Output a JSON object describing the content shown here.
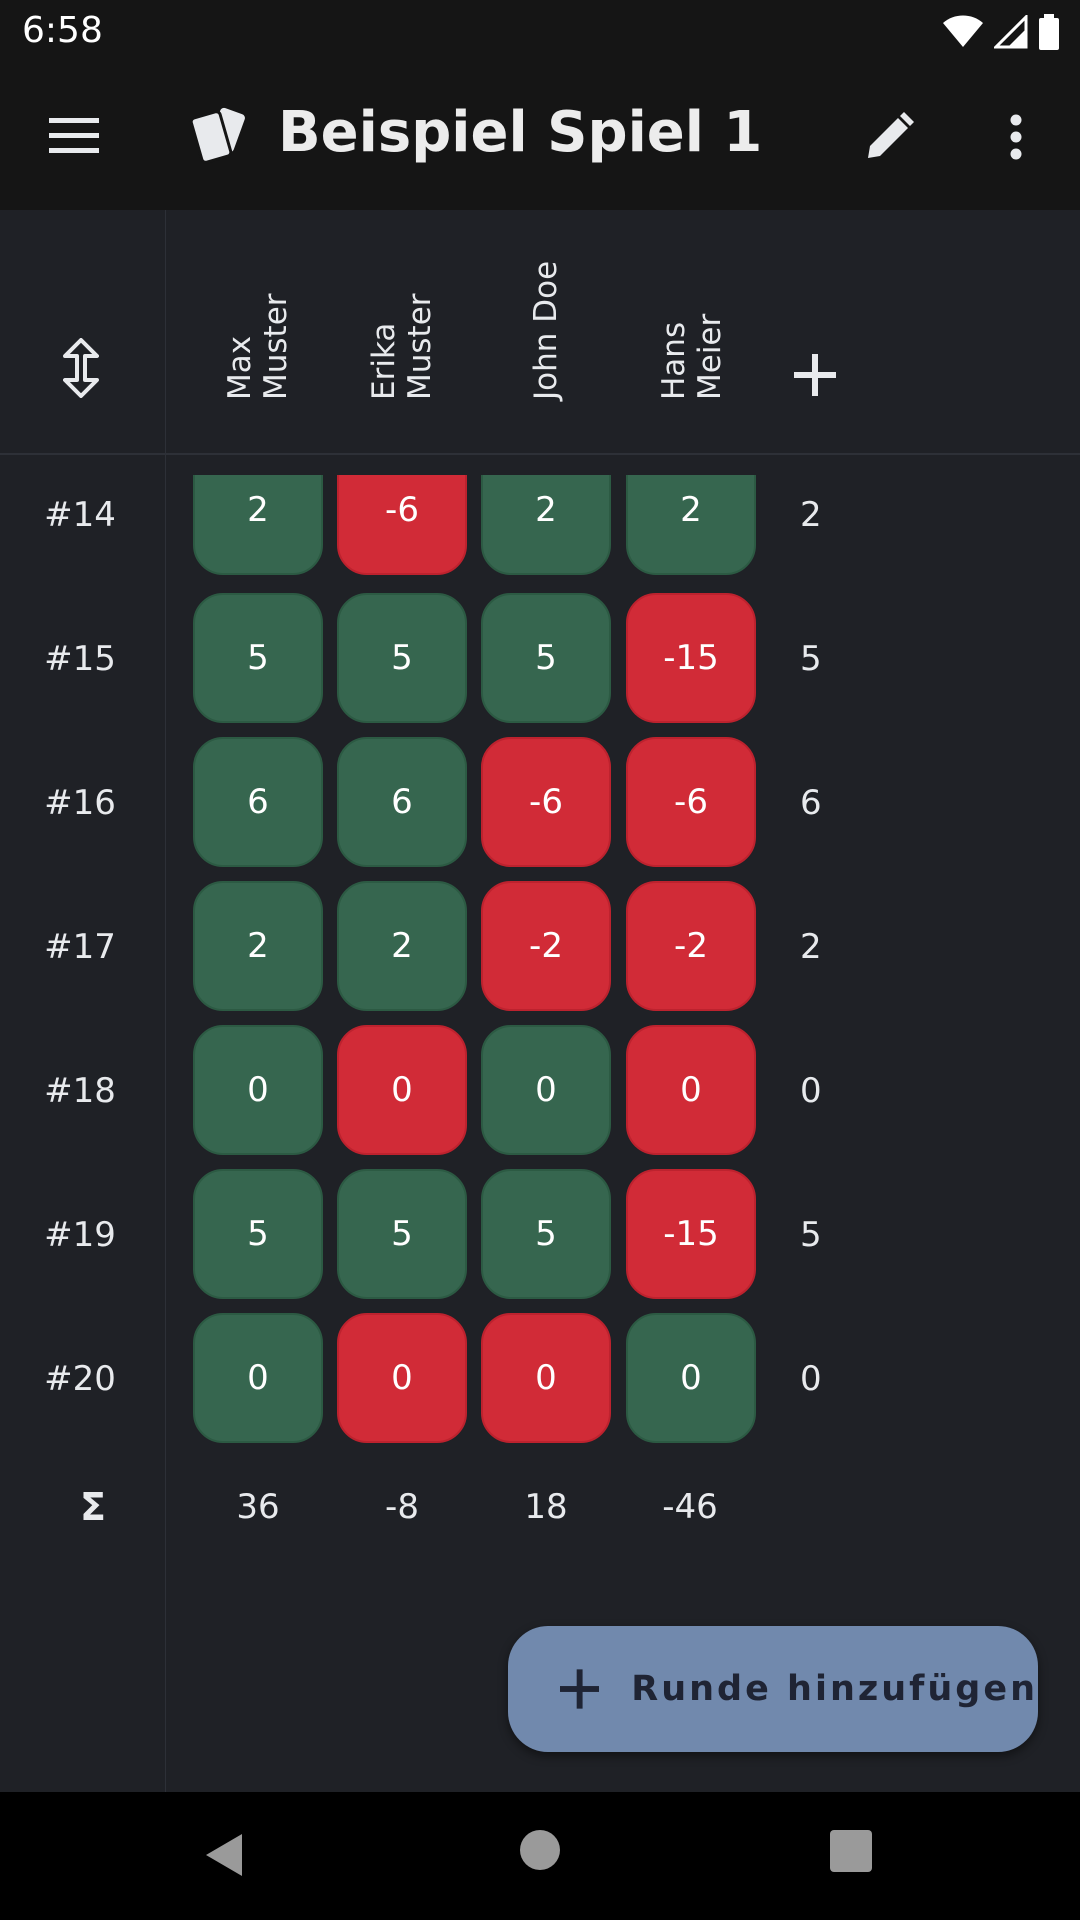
{
  "status_bar": {
    "time": "6:58"
  },
  "app_bar": {
    "title": "Beispiel Spiel 1"
  },
  "players": [
    {
      "line1": "Max",
      "line2": "Muster"
    },
    {
      "line1": "Erika",
      "line2": "Muster"
    },
    {
      "line1": "John Doe",
      "line2": ""
    },
    {
      "line1": "Hans",
      "line2": "Meier"
    }
  ],
  "rounds": [
    {
      "label": "#14",
      "scores": [
        "2",
        "-6",
        "2",
        "2"
      ],
      "signs": [
        "pos",
        "neg",
        "pos",
        "pos"
      ],
      "total": "2"
    },
    {
      "label": "#15",
      "scores": [
        "5",
        "5",
        "5",
        "-15"
      ],
      "signs": [
        "pos",
        "pos",
        "pos",
        "neg"
      ],
      "total": "5"
    },
    {
      "label": "#16",
      "scores": [
        "6",
        "6",
        "-6",
        "-6"
      ],
      "signs": [
        "pos",
        "pos",
        "neg",
        "neg"
      ],
      "total": "6"
    },
    {
      "label": "#17",
      "scores": [
        "2",
        "2",
        "-2",
        "-2"
      ],
      "signs": [
        "pos",
        "pos",
        "neg",
        "neg"
      ],
      "total": "2"
    },
    {
      "label": "#18",
      "scores": [
        "0",
        "0",
        "0",
        "0"
      ],
      "signs": [
        "pos",
        "neg",
        "pos",
        "neg"
      ],
      "total": "0"
    },
    {
      "label": "#19",
      "scores": [
        "5",
        "5",
        "5",
        "-15"
      ],
      "signs": [
        "pos",
        "pos",
        "pos",
        "neg"
      ],
      "total": "5"
    },
    {
      "label": "#20",
      "scores": [
        "0",
        "0",
        "0",
        "0"
      ],
      "signs": [
        "pos",
        "neg",
        "neg",
        "pos"
      ],
      "total": "0"
    }
  ],
  "sum_row": {
    "symbol": "Σ",
    "values": [
      "36",
      "-8",
      "18",
      "-46"
    ]
  },
  "fab": {
    "label": "Runde hinzufügen"
  },
  "colors": {
    "positive": "#36664f",
    "negative": "#d12b37",
    "fab": "#7189ad"
  }
}
